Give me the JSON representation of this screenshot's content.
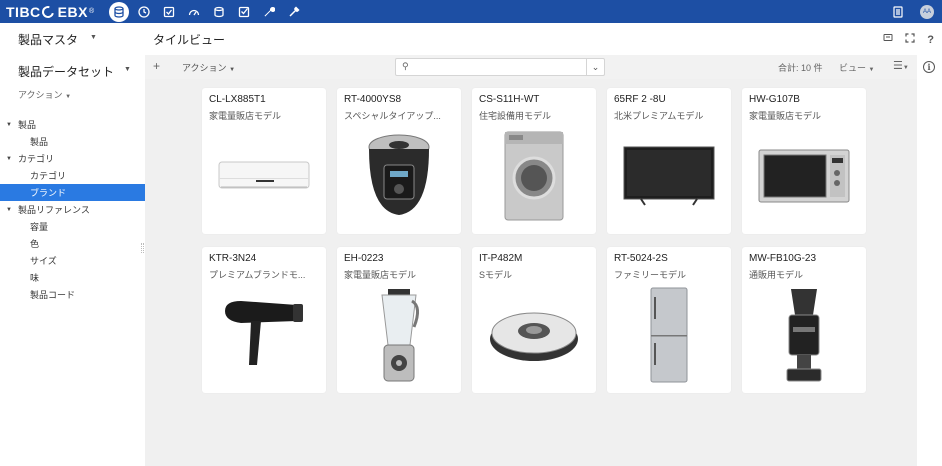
{
  "brand": {
    "tibc": "TIBC",
    "ebx": "EBX",
    "tm": "®"
  },
  "topbar": {
    "icons": [
      "database-icon",
      "clock-icon",
      "checklist-icon",
      "gauge-icon",
      "stack-icon",
      "task-check-icon",
      "wrench-icon",
      "tools-icon"
    ],
    "right_icons": [
      "document-list-icon"
    ],
    "avatar_initials": "AA"
  },
  "left": {
    "title": "製品マスタ",
    "dataset": "製品データセット",
    "action": "アクション",
    "tree": [
      {
        "label": "製品",
        "level": 0,
        "expanded": true,
        "selected": false
      },
      {
        "label": "製品",
        "level": 1,
        "selected": false
      },
      {
        "label": "カテゴリ",
        "level": 0,
        "expanded": true,
        "selected": false
      },
      {
        "label": "カテゴリ",
        "level": 1,
        "selected": false
      },
      {
        "label": "ブランド",
        "level": 1,
        "selected": true
      },
      {
        "label": "製品リファレンス",
        "level": 0,
        "expanded": true,
        "selected": false
      },
      {
        "label": "容量",
        "level": 1,
        "selected": false
      },
      {
        "label": "色",
        "level": 1,
        "selected": false
      },
      {
        "label": "サイズ",
        "level": 1,
        "selected": false
      },
      {
        "label": "味",
        "level": 1,
        "selected": false
      },
      {
        "label": "製品コード",
        "level": 1,
        "selected": false
      }
    ]
  },
  "main": {
    "title": "タイルビュー",
    "toolbar": {
      "add": "+",
      "action": "アクション",
      "search_placeholder": "",
      "total": "合計: 10 件",
      "view": "ビュー"
    }
  },
  "tiles": [
    {
      "code": "CL-LX885T1",
      "subtitle": "家電量販店モデル",
      "image": "air-conditioner"
    },
    {
      "code": "RT-4000YS8",
      "subtitle": "スペシャルタイアップ...",
      "image": "rice-cooker"
    },
    {
      "code": "CS-S11H-WT",
      "subtitle": "住宅設備用モデル",
      "image": "washing-machine"
    },
    {
      "code": "65RF 2 -8U",
      "subtitle": "北米プレミアムモデル",
      "image": "television"
    },
    {
      "code": "HW-G107B",
      "subtitle": "家電量販店モデル",
      "image": "microwave"
    },
    {
      "code": "KTR-3N24",
      "subtitle": "プレミアムブランドモ...",
      "image": "hair-dryer"
    },
    {
      "code": "EH-0223",
      "subtitle": "家電量販店モデル",
      "image": "blender"
    },
    {
      "code": "IT-P482M",
      "subtitle": "Sモデル",
      "image": "robot-vacuum"
    },
    {
      "code": "RT-5024-2S",
      "subtitle": "ファミリーモデル",
      "image": "refrigerator"
    },
    {
      "code": "MW-FB10G-23",
      "subtitle": "通販用モデル",
      "image": "coffee-grinder"
    }
  ]
}
